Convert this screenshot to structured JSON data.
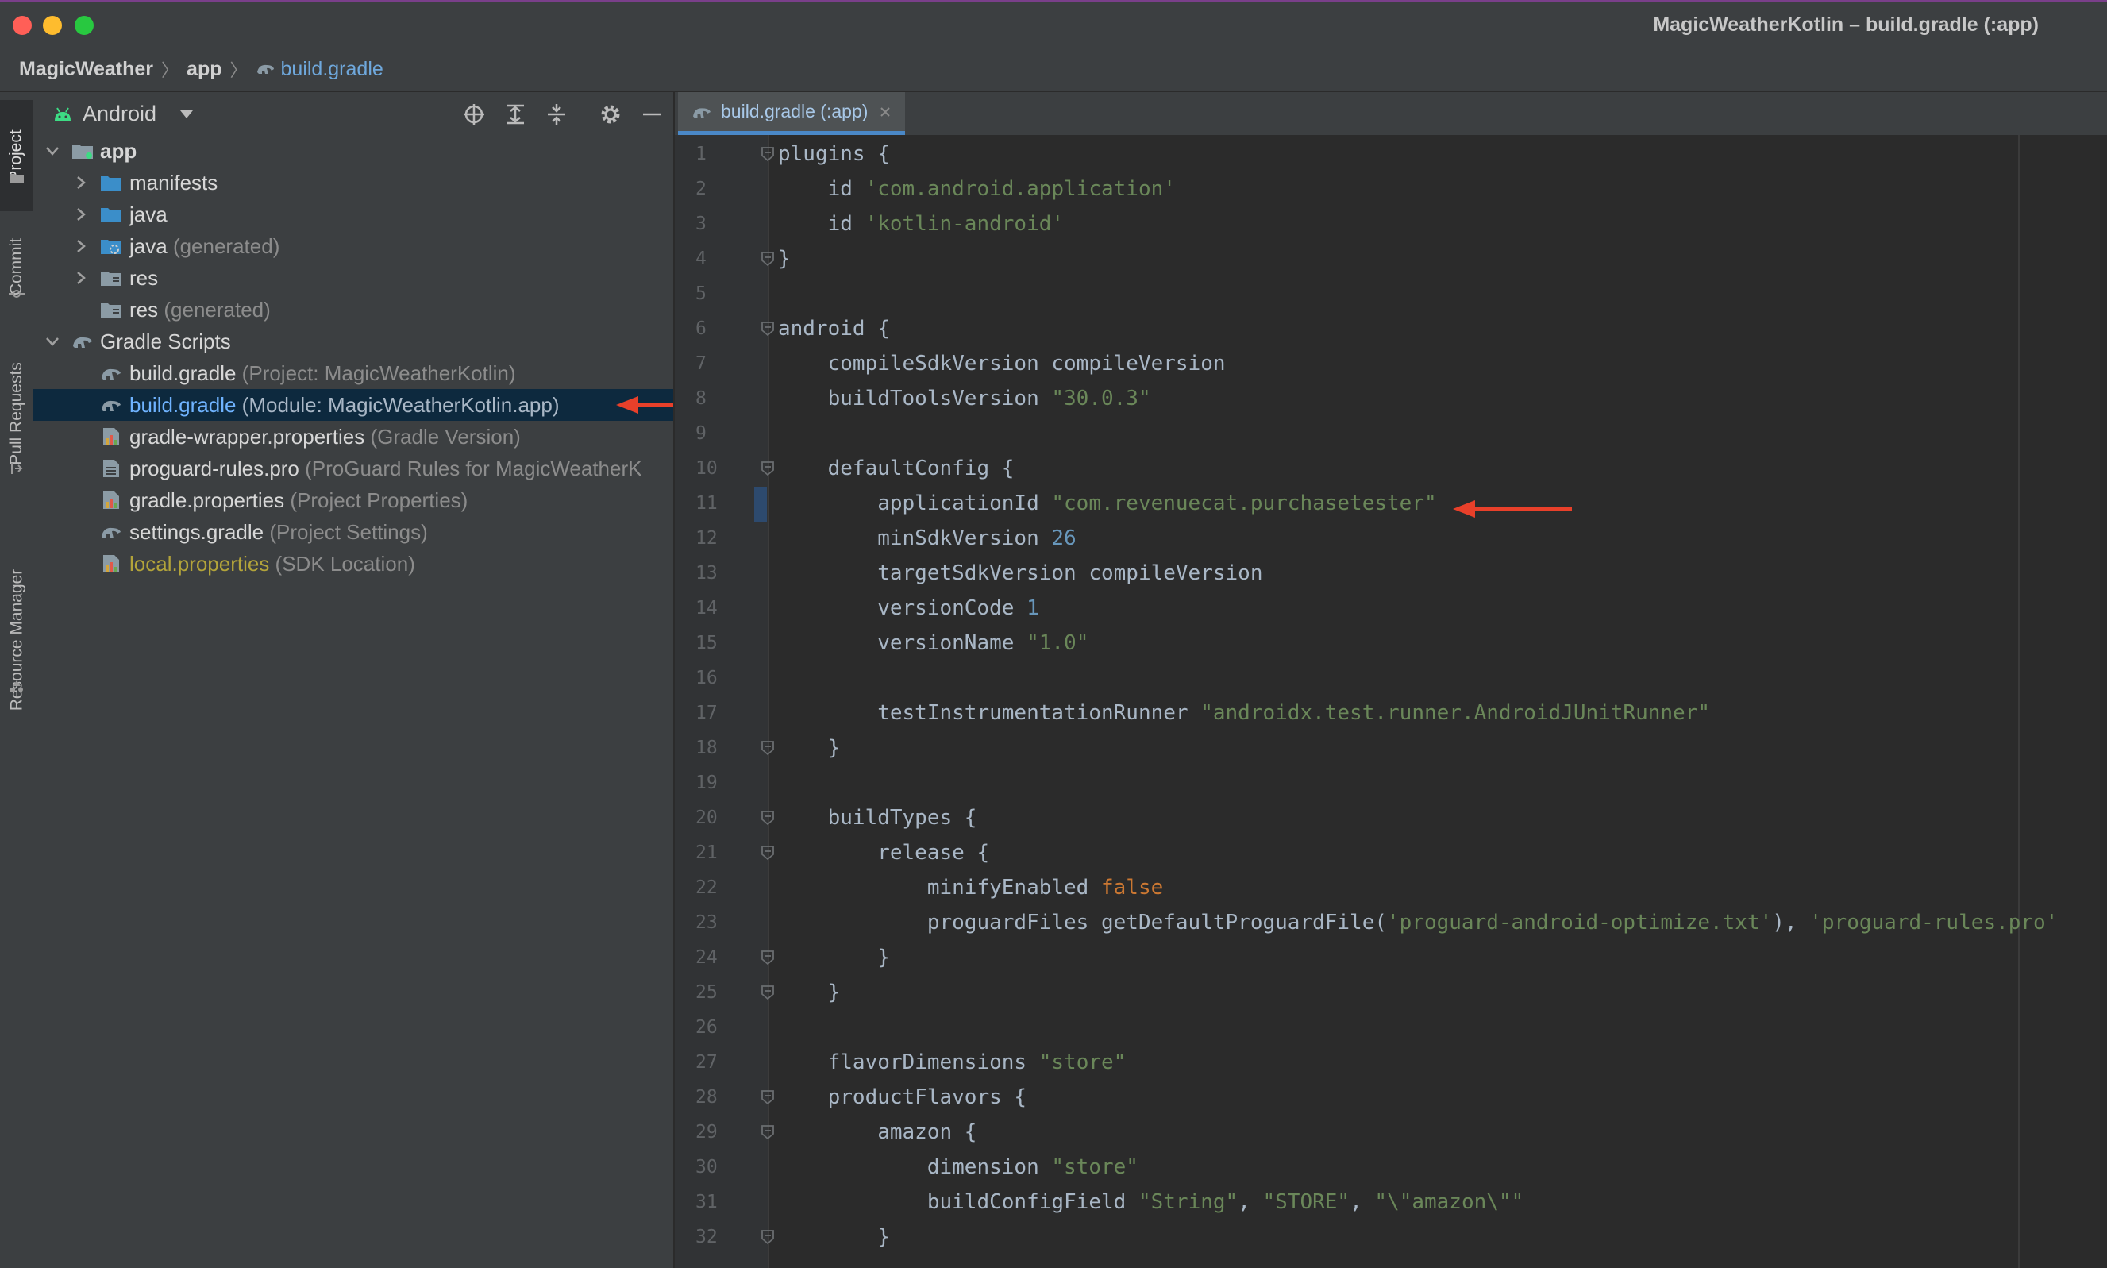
{
  "window": {
    "title": "MagicWeatherKotlin – build.gradle (:app)"
  },
  "breadcrumb": {
    "items": [
      "MagicWeather",
      "app"
    ],
    "file": "build.gradle"
  },
  "toolstrip": {
    "tabs": [
      "Project",
      "Commit",
      "Pull Requests",
      "Resource Manager"
    ]
  },
  "project_panel": {
    "view_mode": "Android",
    "tree": [
      {
        "name": "app",
        "hint": "",
        "level": 0,
        "expanded": true,
        "icon": "module-folder-icon"
      },
      {
        "name": "manifests",
        "hint": "",
        "level": 1,
        "expanded": false,
        "icon": "folder-icon"
      },
      {
        "name": "java",
        "hint": "",
        "level": 1,
        "expanded": false,
        "icon": "folder-icon"
      },
      {
        "name": "java",
        "hint": "(generated)",
        "level": 1,
        "expanded": false,
        "icon": "generated-folder-icon"
      },
      {
        "name": "res",
        "hint": "",
        "level": 1,
        "expanded": false,
        "icon": "res-folder-icon"
      },
      {
        "name": "res",
        "hint": "(generated)",
        "level": 1,
        "expanded": null,
        "icon": "res-folder-icon"
      },
      {
        "name": "Gradle Scripts",
        "hint": "",
        "level": 0,
        "expanded": true,
        "icon": "gradle-icon"
      },
      {
        "name": "build.gradle",
        "hint": "(Project: MagicWeatherKotlin)",
        "level": 1,
        "icon": "gradle-icon"
      },
      {
        "name": "build.gradle",
        "hint": "(Module: MagicWeatherKotlin.app)",
        "level": 1,
        "icon": "gradle-icon",
        "selected": true
      },
      {
        "name": "gradle-wrapper.properties",
        "hint": "(Gradle Version)",
        "level": 1,
        "icon": "properties-icon"
      },
      {
        "name": "proguard-rules.pro",
        "hint": "(ProGuard Rules for MagicWeatherK",
        "level": 1,
        "icon": "text-file-icon"
      },
      {
        "name": "gradle.properties",
        "hint": "(Project Properties)",
        "level": 1,
        "icon": "properties-icon"
      },
      {
        "name": "settings.gradle",
        "hint": "(Project Settings)",
        "level": 1,
        "icon": "gradle-icon"
      },
      {
        "name": "local.properties",
        "hint": "(SDK Location)",
        "level": 1,
        "icon": "properties-icon",
        "highlight": "yellow"
      }
    ]
  },
  "editor": {
    "tab_label": "build.gradle (:app)",
    "lines": [
      "plugins {",
      "    id 'com.android.application'",
      "    id 'kotlin-android'",
      "}",
      "",
      "android {",
      "    compileSdkVersion compileVersion",
      "    buildToolsVersion \"30.0.3\"",
      "",
      "    defaultConfig {",
      "        applicationId \"com.revenuecat.purchasetester\"",
      "        minSdkVersion 26",
      "        targetSdkVersion compileVersion",
      "        versionCode 1",
      "        versionName \"1.0\"",
      "",
      "        testInstrumentationRunner \"androidx.test.runner.AndroidJUnitRunner\"",
      "    }",
      "",
      "    buildTypes {",
      "        release {",
      "            minifyEnabled false",
      "            proguardFiles getDefaultProguardFile('proguard-android-optimize.txt'), 'proguard-rules.pro'",
      "        }",
      "    }",
      "",
      "    flavorDimensions \"store\"",
      "    productFlavors {",
      "        amazon {",
      "            dimension \"store\"",
      "            buildConfigField \"String\", \"STORE\", \"\\\"amazon\\\"\"",
      "        }"
    ]
  },
  "colors": {
    "annotation_arrow": "#e8402a",
    "string": "#6a8759",
    "keyword": "#cc7832",
    "number": "#6897bb",
    "selection": "#0d293e"
  }
}
